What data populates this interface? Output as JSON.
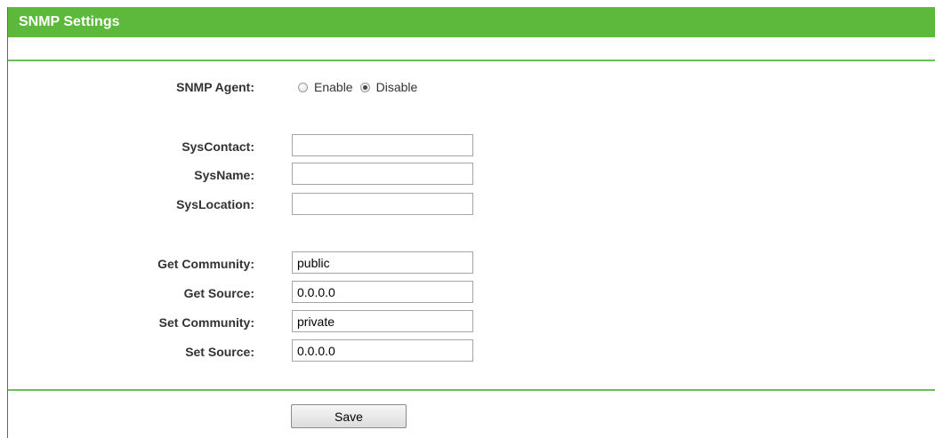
{
  "page": {
    "title": "SNMP Settings"
  },
  "colors": {
    "header_bg": "#5cb93b",
    "divider": "#6cbe5a"
  },
  "snmp_agent": {
    "label": "SNMP Agent:",
    "options": [
      {
        "label": "Enable",
        "checked": false
      },
      {
        "label": "Disable",
        "checked": true
      }
    ]
  },
  "system": {
    "contact": {
      "label": "SysContact:",
      "value": ""
    },
    "name": {
      "label": "SysName:",
      "value": ""
    },
    "location": {
      "label": "SysLocation:",
      "value": ""
    }
  },
  "community": {
    "get_community": {
      "label": "Get Community:",
      "value": "public"
    },
    "get_source": {
      "label": "Get Source:",
      "value": "0.0.0.0"
    },
    "set_community": {
      "label": "Set Community:",
      "value": "private"
    },
    "set_source": {
      "label": "Set Source:",
      "value": "0.0.0.0"
    }
  },
  "actions": {
    "save_label": "Save"
  }
}
